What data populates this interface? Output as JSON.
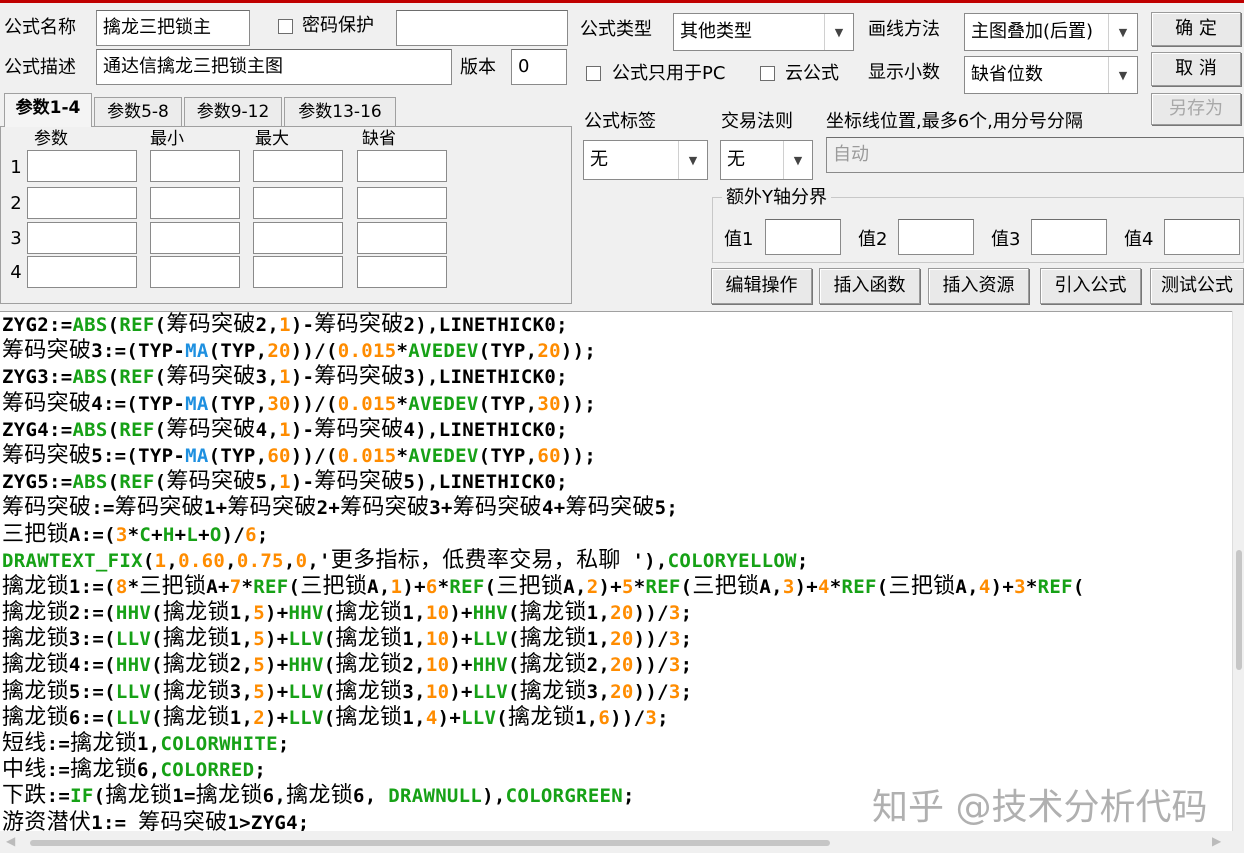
{
  "header": {
    "formula_name_label": "公式名称",
    "formula_name_value": "擒龙三把锁主",
    "password_label": "密码保护",
    "formula_desc_label": "公式描述",
    "formula_desc_value": "通达信擒龙三把锁主图",
    "version_label": "版本",
    "version_value": "0",
    "formula_type_label": "公式类型",
    "formula_type_value": "其他类型",
    "draw_method_label": "画线方法",
    "draw_method_value": "主图叠加(后置)",
    "pc_only_label": "公式只用于PC",
    "cloud_label": "云公式",
    "decimals_label": "显示小数",
    "decimals_value": "缺省位数",
    "tag_label": "公式标签",
    "tag_value": "无",
    "trade_rule_label": "交易法则",
    "trade_rule_value": "无",
    "coord_label": "坐标线位置,最多6个,用分号分隔",
    "coord_value": "自动",
    "extra_y_label": "额外Y轴分界",
    "val_labels": [
      "值1",
      "值2",
      "值3",
      "值4"
    ]
  },
  "buttons": {
    "ok": "确  定",
    "cancel": "取  消",
    "save_as": "另存为",
    "edit_ops": "编辑操作",
    "insert_func": "插入函数",
    "insert_res": "插入资源",
    "import_formula": "引入公式",
    "test_formula": "测试公式"
  },
  "params": {
    "tabs": [
      "参数1-4",
      "参数5-8",
      "参数9-12",
      "参数13-16"
    ],
    "columns": [
      "参数",
      "最小",
      "最大",
      "缺省"
    ],
    "rows": [
      "1",
      "2",
      "3",
      "4"
    ]
  },
  "code_lines": [
    [
      [
        "ZYG2:=",
        ""
      ],
      [
        "ABS",
        "g"
      ],
      [
        "(",
        ""
      ],
      [
        "REF",
        "g"
      ],
      [
        "(筹码突破2,",
        ""
      ],
      [
        "1",
        "o"
      ],
      [
        ")-筹码突破2),LINETHICK0;",
        ""
      ]
    ],
    [
      [
        "筹码突破3:=(TYP-",
        ""
      ],
      [
        "MA",
        "b"
      ],
      [
        "(TYP,",
        ""
      ],
      [
        "20",
        "o"
      ],
      [
        "))/(",
        ""
      ],
      [
        "0.015",
        "o"
      ],
      [
        "*",
        ""
      ],
      [
        "AVEDEV",
        "g"
      ],
      [
        "(TYP,",
        ""
      ],
      [
        "20",
        "o"
      ],
      [
        "));",
        ""
      ]
    ],
    [
      [
        "ZYG3:=",
        ""
      ],
      [
        "ABS",
        "g"
      ],
      [
        "(",
        ""
      ],
      [
        "REF",
        "g"
      ],
      [
        "(筹码突破3,",
        ""
      ],
      [
        "1",
        "o"
      ],
      [
        ")-筹码突破3),LINETHICK0;",
        ""
      ]
    ],
    [
      [
        "筹码突破4:=(TYP-",
        ""
      ],
      [
        "MA",
        "b"
      ],
      [
        "(TYP,",
        ""
      ],
      [
        "30",
        "o"
      ],
      [
        "))/(",
        ""
      ],
      [
        "0.015",
        "o"
      ],
      [
        "*",
        ""
      ],
      [
        "AVEDEV",
        "g"
      ],
      [
        "(TYP,",
        ""
      ],
      [
        "30",
        "o"
      ],
      [
        "));",
        ""
      ]
    ],
    [
      [
        "ZYG4:=",
        ""
      ],
      [
        "ABS",
        "g"
      ],
      [
        "(",
        ""
      ],
      [
        "REF",
        "g"
      ],
      [
        "(筹码突破4,",
        ""
      ],
      [
        "1",
        "o"
      ],
      [
        ")-筹码突破4),LINETHICK0;",
        ""
      ]
    ],
    [
      [
        "筹码突破5:=(TYP-",
        ""
      ],
      [
        "MA",
        "b"
      ],
      [
        "(TYP,",
        ""
      ],
      [
        "60",
        "o"
      ],
      [
        "))/(",
        ""
      ],
      [
        "0.015",
        "o"
      ],
      [
        "*",
        ""
      ],
      [
        "AVEDEV",
        "g"
      ],
      [
        "(TYP,",
        ""
      ],
      [
        "60",
        "o"
      ],
      [
        "));",
        ""
      ]
    ],
    [
      [
        "ZYG5:=",
        ""
      ],
      [
        "ABS",
        "g"
      ],
      [
        "(",
        ""
      ],
      [
        "REF",
        "g"
      ],
      [
        "(筹码突破5,",
        ""
      ],
      [
        "1",
        "o"
      ],
      [
        ")-筹码突破5),LINETHICK0;",
        ""
      ]
    ],
    [
      [
        "筹码突破:=筹码突破1+筹码突破2+筹码突破3+筹码突破4+筹码突破5;",
        ""
      ]
    ],
    [
      [
        "三把锁A:=(",
        ""
      ],
      [
        "3",
        "o"
      ],
      [
        "*",
        ""
      ],
      [
        "C",
        "g"
      ],
      [
        "+",
        ""
      ],
      [
        "H",
        "g"
      ],
      [
        "+",
        ""
      ],
      [
        "L",
        "g"
      ],
      [
        "+",
        ""
      ],
      [
        "O",
        "g"
      ],
      [
        ")/",
        ""
      ],
      [
        "6",
        "o"
      ],
      [
        ";",
        ""
      ]
    ],
    [
      [
        "DRAWTEXT_FIX",
        "g"
      ],
      [
        "(",
        ""
      ],
      [
        "1",
        "o"
      ],
      [
        ",",
        ""
      ],
      [
        "0.60",
        "o"
      ],
      [
        ",",
        ""
      ],
      [
        "0.75",
        "o"
      ],
      [
        ",",
        ""
      ],
      [
        "0",
        "o"
      ],
      [
        ",'更多指标，低费率交易，私聊 '),",
        ""
      ],
      [
        "COLORYELLOW",
        "g"
      ],
      [
        ";",
        ""
      ]
    ],
    [
      [
        "擒龙锁1:=(",
        ""
      ],
      [
        "8",
        "o"
      ],
      [
        "*三把锁A+",
        ""
      ],
      [
        "7",
        "o"
      ],
      [
        "*",
        ""
      ],
      [
        "REF",
        "g"
      ],
      [
        "(三把锁A,",
        ""
      ],
      [
        "1",
        "o"
      ],
      [
        ")+",
        ""
      ],
      [
        "6",
        "o"
      ],
      [
        "*",
        ""
      ],
      [
        "REF",
        "g"
      ],
      [
        "(三把锁A,",
        ""
      ],
      [
        "2",
        "o"
      ],
      [
        ")+",
        ""
      ],
      [
        "5",
        "o"
      ],
      [
        "*",
        ""
      ],
      [
        "REF",
        "g"
      ],
      [
        "(三把锁A,",
        ""
      ],
      [
        "3",
        "o"
      ],
      [
        ")+",
        ""
      ],
      [
        "4",
        "o"
      ],
      [
        "*",
        ""
      ],
      [
        "REF",
        "g"
      ],
      [
        "(三把锁A,",
        ""
      ],
      [
        "4",
        "o"
      ],
      [
        ")+",
        ""
      ],
      [
        "3",
        "o"
      ],
      [
        "*",
        ""
      ],
      [
        "REF",
        "g"
      ],
      [
        "(",
        ""
      ]
    ],
    [
      [
        "擒龙锁2:=(",
        ""
      ],
      [
        "HHV",
        "g"
      ],
      [
        "(擒龙锁1,",
        ""
      ],
      [
        "5",
        "o"
      ],
      [
        ")+",
        ""
      ],
      [
        "HHV",
        "g"
      ],
      [
        "(擒龙锁1,",
        ""
      ],
      [
        "10",
        "o"
      ],
      [
        ")+",
        ""
      ],
      [
        "HHV",
        "g"
      ],
      [
        "(擒龙锁1,",
        ""
      ],
      [
        "20",
        "o"
      ],
      [
        "))/",
        ""
      ],
      [
        "3",
        "o"
      ],
      [
        ";",
        ""
      ]
    ],
    [
      [
        "擒龙锁3:=(",
        ""
      ],
      [
        "LLV",
        "g"
      ],
      [
        "(擒龙锁1,",
        ""
      ],
      [
        "5",
        "o"
      ],
      [
        ")+",
        ""
      ],
      [
        "LLV",
        "g"
      ],
      [
        "(擒龙锁1,",
        ""
      ],
      [
        "10",
        "o"
      ],
      [
        ")+",
        ""
      ],
      [
        "LLV",
        "g"
      ],
      [
        "(擒龙锁1,",
        ""
      ],
      [
        "20",
        "o"
      ],
      [
        "))/",
        ""
      ],
      [
        "3",
        "o"
      ],
      [
        ";",
        ""
      ]
    ],
    [
      [
        "擒龙锁4:=(",
        ""
      ],
      [
        "HHV",
        "g"
      ],
      [
        "(擒龙锁2,",
        ""
      ],
      [
        "5",
        "o"
      ],
      [
        ")+",
        ""
      ],
      [
        "HHV",
        "g"
      ],
      [
        "(擒龙锁2,",
        ""
      ],
      [
        "10",
        "o"
      ],
      [
        ")+",
        ""
      ],
      [
        "HHV",
        "g"
      ],
      [
        "(擒龙锁2,",
        ""
      ],
      [
        "20",
        "o"
      ],
      [
        "))/",
        ""
      ],
      [
        "3",
        "o"
      ],
      [
        ";",
        ""
      ]
    ],
    [
      [
        "擒龙锁5:=(",
        ""
      ],
      [
        "LLV",
        "g"
      ],
      [
        "(擒龙锁3,",
        ""
      ],
      [
        "5",
        "o"
      ],
      [
        ")+",
        ""
      ],
      [
        "LLV",
        "g"
      ],
      [
        "(擒龙锁3,",
        ""
      ],
      [
        "10",
        "o"
      ],
      [
        ")+",
        ""
      ],
      [
        "LLV",
        "g"
      ],
      [
        "(擒龙锁3,",
        ""
      ],
      [
        "20",
        "o"
      ],
      [
        "))/",
        ""
      ],
      [
        "3",
        "o"
      ],
      [
        ";",
        ""
      ]
    ],
    [
      [
        "擒龙锁6:=(",
        ""
      ],
      [
        "LLV",
        "g"
      ],
      [
        "(擒龙锁1,",
        ""
      ],
      [
        "2",
        "o"
      ],
      [
        ")+",
        ""
      ],
      [
        "LLV",
        "g"
      ],
      [
        "(擒龙锁1,",
        ""
      ],
      [
        "4",
        "o"
      ],
      [
        ")+",
        ""
      ],
      [
        "LLV",
        "g"
      ],
      [
        "(擒龙锁1,",
        ""
      ],
      [
        "6",
        "o"
      ],
      [
        "))/",
        ""
      ],
      [
        "3",
        "o"
      ],
      [
        ";",
        ""
      ]
    ],
    [
      [
        "短线:=擒龙锁1,",
        ""
      ],
      [
        "COLORWHITE",
        "g"
      ],
      [
        ";",
        ""
      ]
    ],
    [
      [
        "中线:=擒龙锁6,",
        ""
      ],
      [
        "COLORRED",
        "g"
      ],
      [
        ";",
        ""
      ]
    ],
    [
      [
        "下跌:=",
        ""
      ],
      [
        "IF",
        "g"
      ],
      [
        "(擒龙锁1=擒龙锁6,擒龙锁6, ",
        ""
      ],
      [
        "DRAWNULL",
        "g"
      ],
      [
        "),",
        ""
      ],
      [
        "COLORGREEN",
        "g"
      ],
      [
        ";",
        ""
      ]
    ],
    [
      [
        "游资潜伏1:= 筹码突破1>ZYG4;",
        ""
      ]
    ]
  ],
  "watermark": "知乎 @技术分析代码",
  "colors": {
    "keyword": "#16a116",
    "number": "#ff8c00",
    "ma": "#1e90e0",
    "top_bar": "#c00000"
  }
}
